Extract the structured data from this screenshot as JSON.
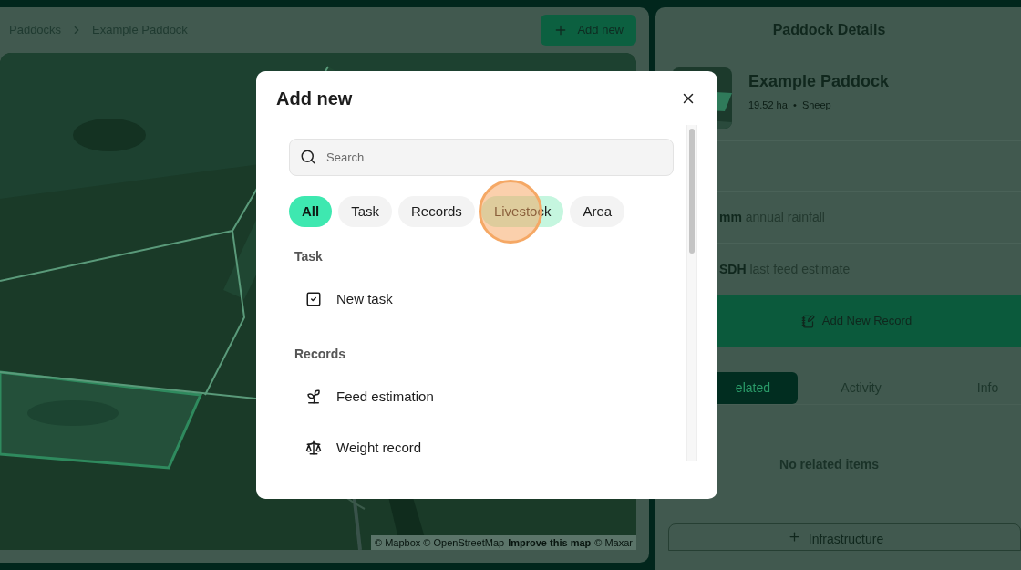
{
  "breadcrumbs": [
    {
      "label": "Paddocks"
    },
    {
      "label": "Example Paddock"
    }
  ],
  "header_button": "Add new",
  "map_attribution": {
    "text": "© Mapbox © OpenStreetMap",
    "link": "Improve this map",
    "tail": "© Maxar"
  },
  "details": {
    "title": "Paddock Details",
    "name": "Example Paddock",
    "meta": "19.52 ha  •  Sheep",
    "stats": [
      "**mm** annual rainfall",
      "**SDH** last feed estimate"
    ],
    "add_record": "Add New Record",
    "tabs": [
      {
        "label": "elated",
        "selected": true
      },
      {
        "label": "Activity",
        "selected": false
      },
      {
        "label": "Info",
        "selected": false
      }
    ],
    "empty": "No related items",
    "infrastructure": "Infrastructure"
  },
  "modal": {
    "title": "Add new",
    "search": {
      "placeholder": "Search"
    },
    "chips": [
      {
        "label": "All",
        "selected": true,
        "hovered": false
      },
      {
        "label": "Task",
        "selected": false,
        "hovered": false
      },
      {
        "label": "Records",
        "selected": false,
        "hovered": false
      },
      {
        "label": "Livestock",
        "selected": false,
        "hovered": true
      },
      {
        "label": "Area",
        "selected": false,
        "hovered": false
      }
    ],
    "sections": [
      {
        "title": "Task",
        "items": [
          {
            "label": "New task",
            "kind": "task"
          }
        ]
      },
      {
        "title": "Records",
        "items": [
          {
            "label": "Feed estimation",
            "kind": "feed"
          },
          {
            "label": "Weight record",
            "kind": "weight"
          }
        ]
      }
    ]
  }
}
